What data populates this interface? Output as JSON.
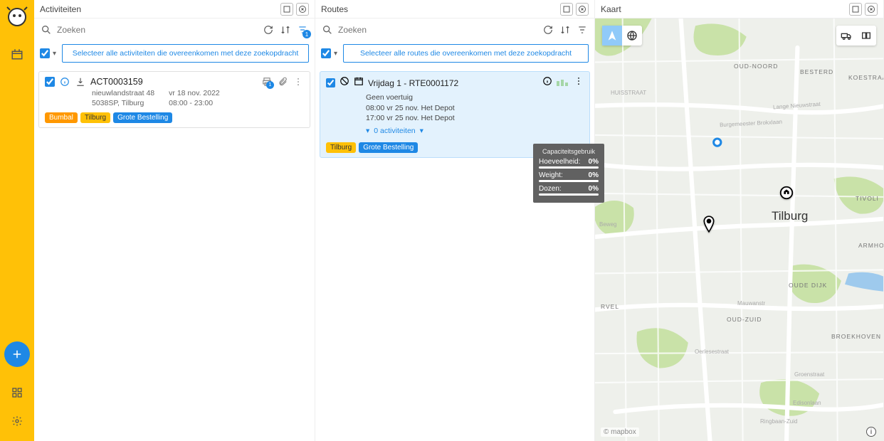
{
  "sidebar": {
    "logo_label": "bumbal-logo",
    "fab_label": "+"
  },
  "activities_panel": {
    "title": "Activiteiten",
    "search_placeholder": "Zoeken",
    "select_all_label": "Selecteer alle activiteiten die overeenkomen met deze zoekopdracht",
    "filter_badge": "1",
    "card": {
      "id": "ACT0003159",
      "address_line1": "nieuwlandstraat 48",
      "address_line2": "5038SP, Tilburg",
      "date": "vr 18 nov. 2022",
      "time": "08:00 - 23:00",
      "print_badge": "1",
      "tags": {
        "bumbal": "Bumbal",
        "tilburg": "Tilburg",
        "grote": "Grote Bestelling"
      }
    }
  },
  "routes_panel": {
    "title": "Routes",
    "search_placeholder": "Zoeken",
    "select_all_label": "Selecteer alle routes die overeenkomen met deze zoekopdracht",
    "card": {
      "title": "Vrijdag 1 - RTE0001172",
      "no_vehicle": "Geen voertuig",
      "line1": "08:00 vr 25 nov. Het Depot",
      "line2": "17:00 vr 25 nov. Het Depot",
      "expand_label": "0 activiteiten",
      "tags": {
        "tilburg": "Tilburg",
        "grote": "Grote Bestelling"
      }
    },
    "tooltip": {
      "title": "Capaciteitsgebruik",
      "rows": [
        {
          "k": "Hoeveelheid:",
          "v": "0%"
        },
        {
          "k": "Weight:",
          "v": "0%"
        },
        {
          "k": "Dozen:",
          "v": "0%"
        }
      ]
    }
  },
  "map_panel": {
    "title": "Kaart",
    "city": "Tilburg",
    "attribution": "© mapbox",
    "districts": {
      "oudnoord": "OUD-NOORD",
      "besterd": "BESTERD",
      "koestraat": "KOESTRAAT",
      "tivoli": "TIVOLI",
      "oudedijk": "OUDE DIJK",
      "oudzuid": "OUD-ZUID",
      "broekhoven": "BROEKHOVEN",
      "armhoef": "ARMHOEF",
      "rvel": "RVEL"
    },
    "streets": {
      "huisstraat": "HUISSTRAAT",
      "langenieuw": "Lange Nieuwstraat",
      "burgemeester": "Burgemeester Brokxlaan",
      "beweg": "Beweg",
      "mauwanstr": "Mauwanstr",
      "oerlesestr": "Oerlesestraat",
      "groenstr": "Groenstraat",
      "edisonlaan": "Edisonlaan",
      "ringbaan": "Ringbaan-Zuid"
    }
  }
}
